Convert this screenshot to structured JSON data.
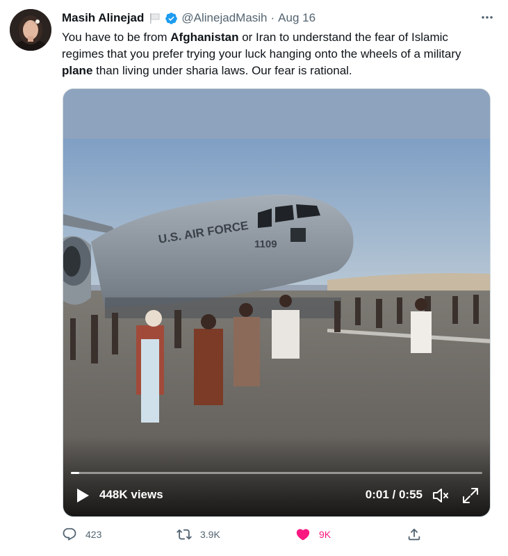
{
  "author": {
    "name": "Masih Alinejad",
    "handle": "@AlinejadMasih",
    "separator": "·",
    "date": "Aug 16"
  },
  "tweet": {
    "segments": [
      {
        "text": "You have to be from ",
        "bold": false
      },
      {
        "text": "Afghanistan",
        "bold": true
      },
      {
        "text": " or Iran to understand the fear of Islamic regimes that you prefer trying your luck hanging onto the wheels of a military ",
        "bold": false
      },
      {
        "text": "plane",
        "bold": true
      },
      {
        "text": " than living under sharia laws. Our fear is rational.",
        "bold": false
      }
    ]
  },
  "media": {
    "aircraft_marking": "U.S. AIR FORCE",
    "tail_number": "1109",
    "views": "448K views",
    "time": "0:01 / 0:55",
    "progress_fraction": 0.02
  },
  "actions": {
    "replies": "423",
    "retweets": "3.9K",
    "likes": "9K"
  },
  "colors": {
    "secondary_text": "#536471",
    "verified": "#1d9bf0",
    "like": "#f91880"
  },
  "icons": [
    "flag-icon",
    "verified-icon",
    "more-icon",
    "play-icon",
    "volume-icon",
    "expand-icon",
    "reply-icon",
    "retweet-icon",
    "heart-icon",
    "share-icon"
  ]
}
